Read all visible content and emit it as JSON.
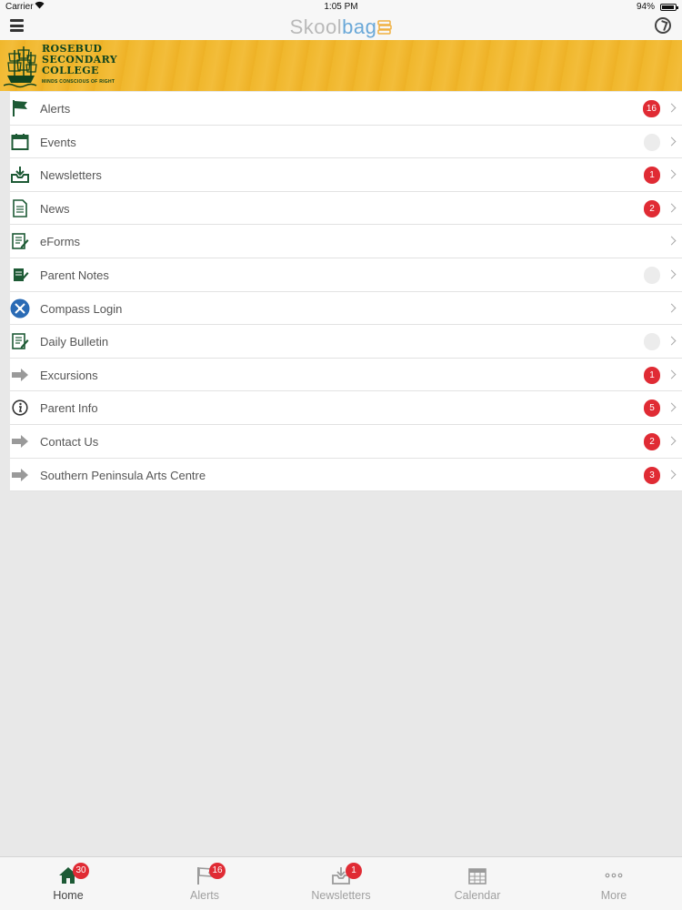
{
  "status_bar": {
    "carrier": "Carrier",
    "time": "1:05 PM",
    "battery": "94%"
  },
  "nav": {
    "logo_part1": "Skool",
    "logo_part2": "bag"
  },
  "banner": {
    "school_line1": "ROSEBUD",
    "school_line2": "SECONDARY",
    "school_line3": "COLLEGE",
    "motto": "MINDS CONSCIOUS OF RIGHT"
  },
  "menu": [
    {
      "label": "Alerts",
      "badge": "16",
      "icon": "flag-icon"
    },
    {
      "label": "Events",
      "badge": "",
      "icon": "calendar-icon"
    },
    {
      "label": "Newsletters",
      "badge": "1",
      "icon": "inbox-download-icon"
    },
    {
      "label": "News",
      "badge": "2",
      "icon": "document-icon"
    },
    {
      "label": "eForms",
      "badge": null,
      "icon": "form-edit-icon"
    },
    {
      "label": "Parent Notes",
      "badge": "",
      "icon": "notes-edit-icon"
    },
    {
      "label": "Compass Login",
      "badge": null,
      "icon": "compass-icon"
    },
    {
      "label": "Daily Bulletin",
      "badge": "",
      "icon": "bulletin-edit-icon"
    },
    {
      "label": "Excursions",
      "badge": "1",
      "icon": "arrow-right-icon"
    },
    {
      "label": "Parent Info",
      "badge": "5",
      "icon": "info-icon"
    },
    {
      "label": "Contact Us",
      "badge": "2",
      "icon": "arrow-right-icon"
    },
    {
      "label": "Southern Peninsula Arts Centre",
      "badge": "3",
      "icon": "arrow-right-icon"
    }
  ],
  "tabs": [
    {
      "label": "Home",
      "badge": "30",
      "icon": "home-icon",
      "active": true
    },
    {
      "label": "Alerts",
      "badge": "16",
      "icon": "flag-icon",
      "active": false
    },
    {
      "label": "Newsletters",
      "badge": "1",
      "icon": "inbox-download-icon",
      "active": false
    },
    {
      "label": "Calendar",
      "badge": null,
      "icon": "calendar-icon",
      "active": false
    },
    {
      "label": "More",
      "badge": null,
      "icon": "more-dots-icon",
      "active": false
    }
  ],
  "colors": {
    "accent_green": "#1d5a35",
    "badge_red": "#e02b34",
    "banner_gold": "#f0b72c",
    "compass_blue": "#2a6bb5"
  }
}
